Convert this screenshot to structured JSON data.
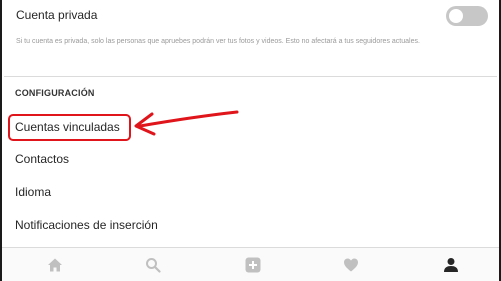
{
  "privacy": {
    "title": "Cuenta privada",
    "description": "Si tu cuenta es privada, solo las personas que apruebes podrán ver tus fotos y videos. Esto no afectará a tus seguidores actuales.",
    "toggle_state": "off"
  },
  "configuration": {
    "heading": "CONFIGURACIÓN",
    "items": [
      {
        "label": "Cuentas vinculadas",
        "highlighted": true
      },
      {
        "label": "Contactos"
      },
      {
        "label": "Idioma"
      },
      {
        "label": "Notificaciones de inserción"
      }
    ]
  },
  "annotation": {
    "color": "#e0141b"
  },
  "bottom_nav": {
    "items": [
      {
        "icon": "home-icon",
        "active": false
      },
      {
        "icon": "search-icon",
        "active": false
      },
      {
        "icon": "add-post-icon",
        "active": false
      },
      {
        "icon": "heart-icon",
        "active": false
      },
      {
        "icon": "profile-icon",
        "active": true
      }
    ],
    "inactive_color": "#c0c0c0",
    "active_color": "#262626"
  }
}
